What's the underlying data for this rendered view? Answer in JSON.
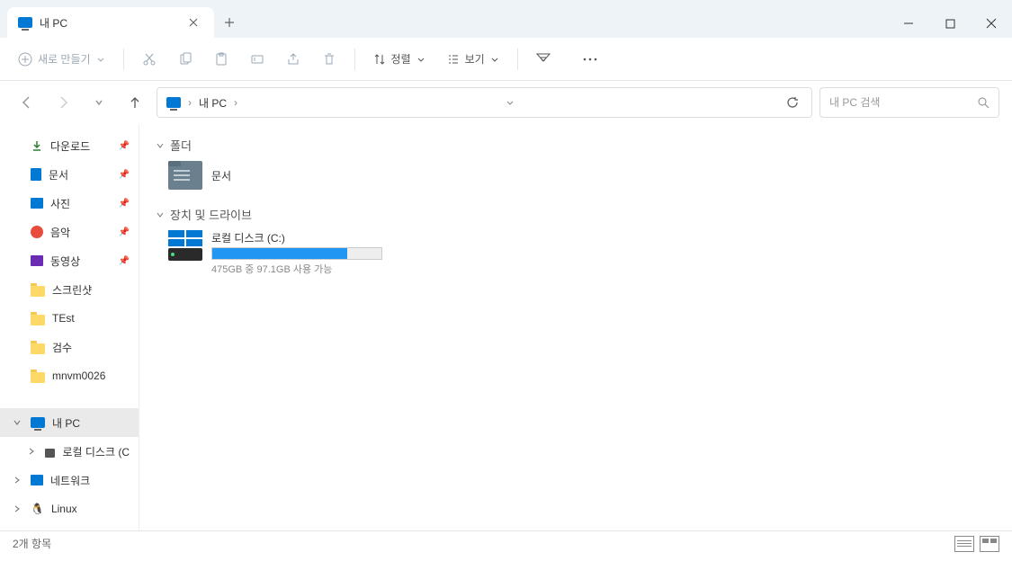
{
  "window": {
    "title": "내 PC"
  },
  "toolbar": {
    "new_label": "새로 만들기",
    "sort_label": "정렬",
    "view_label": "보기"
  },
  "address": {
    "location": "내 PC",
    "separator": "›"
  },
  "search": {
    "placeholder": "내 PC 검색"
  },
  "sidebar": {
    "items": [
      {
        "label": "다운로드",
        "pinned": true
      },
      {
        "label": "문서",
        "pinned": true
      },
      {
        "label": "사진",
        "pinned": true
      },
      {
        "label": "음악",
        "pinned": true
      },
      {
        "label": "동영상",
        "pinned": true
      },
      {
        "label": "스크린샷",
        "pinned": false
      },
      {
        "label": "TEst",
        "pinned": false
      },
      {
        "label": "검수",
        "pinned": false
      },
      {
        "label": "mnvm0026",
        "pinned": false
      }
    ],
    "my_pc": "내 PC",
    "local_disk": "로컬 디스크 (C",
    "network": "네트워크",
    "linux": "Linux"
  },
  "main": {
    "sections": {
      "folders": {
        "title": "폴더"
      },
      "devices": {
        "title": "장치 및 드라이브"
      }
    },
    "folder_item": {
      "name": "문서"
    },
    "drive": {
      "name": "로컬 디스크 (C:)",
      "info": "475GB 중 97.1GB 사용 가능",
      "fill_percent": 80
    }
  },
  "status": {
    "text": "2개 항목"
  }
}
